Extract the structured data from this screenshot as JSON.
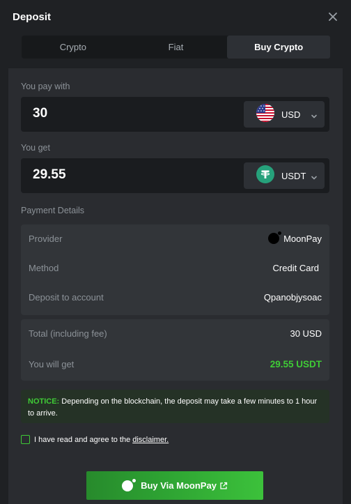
{
  "dialog": {
    "title": "Deposit"
  },
  "tabs": [
    {
      "label": "Crypto",
      "active": false
    },
    {
      "label": "Fiat",
      "active": false
    },
    {
      "label": "Buy Crypto",
      "active": true
    }
  ],
  "pay": {
    "label": "You pay with",
    "amount": "30",
    "currency": "USD",
    "icon": "us-flag-icon"
  },
  "get": {
    "label": "You get",
    "amount": "29.55",
    "currency": "USDT",
    "icon": "tether-icon"
  },
  "payment_details": {
    "heading": "Payment Details",
    "rows": [
      {
        "label": "Provider",
        "value": "MoonPay"
      },
      {
        "label": "Method",
        "value": "Credit Card"
      },
      {
        "label": "Deposit to account",
        "value": "Qpanobjysoac"
      }
    ]
  },
  "summary": {
    "total_label": "Total (including fee)",
    "total_value": "30 USD",
    "get_label": "You will get",
    "get_value": "29.55 USDT"
  },
  "notice": {
    "tag": "NOTICE:",
    "text": "Depending on the blockchain, the deposit may take a few minutes to 1 hour to arrive."
  },
  "agreement": {
    "text": "I have read and agree to the",
    "link": "disclaimer."
  },
  "buy_button": {
    "label": "Buy Via MoonPay"
  },
  "colors": {
    "accent_green": "#3fcb36",
    "tether": "#26a17b",
    "background": "#1f2124",
    "panel": "#2a2c30"
  }
}
